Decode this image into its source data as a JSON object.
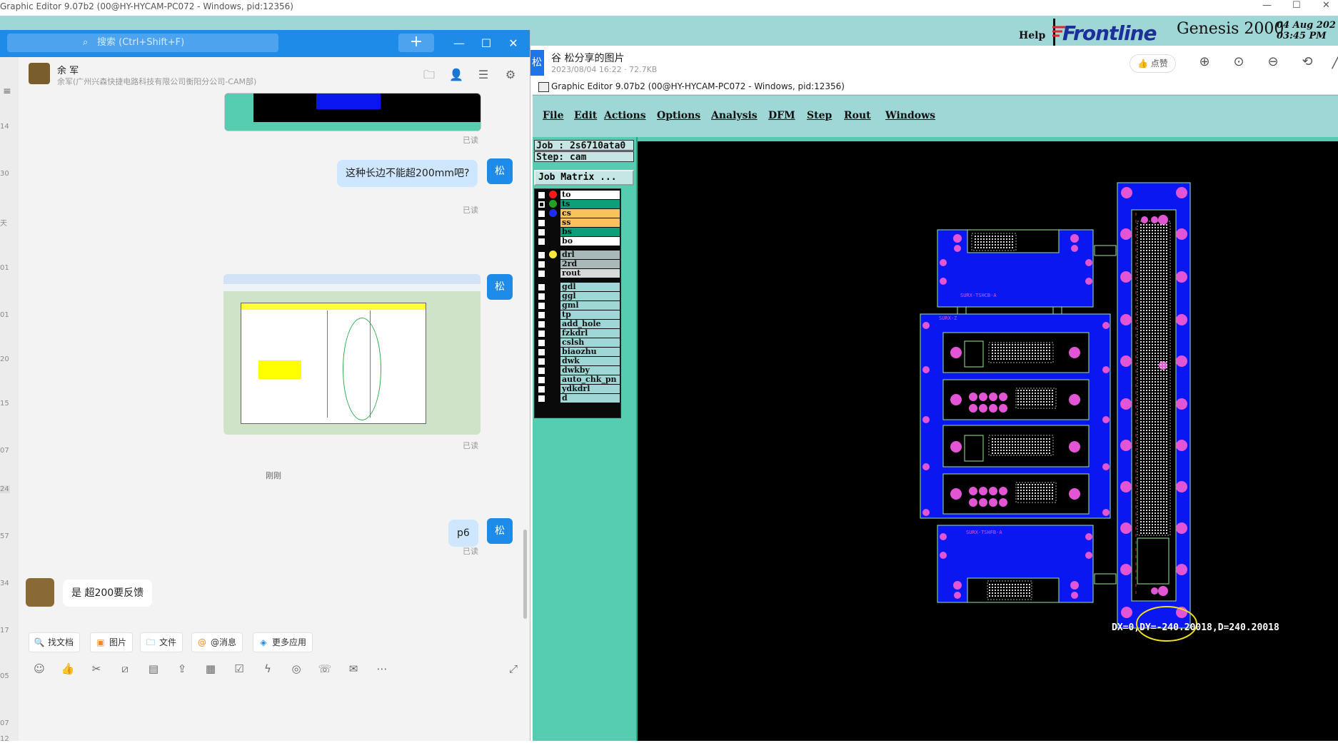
{
  "bg_window": {
    "title": "Graphic Editor 9.07b2 (00@HY-HYCAM-PC072 - Windows, pid:12356)",
    "help": "Help",
    "logo": "Frontline",
    "product": "Genesis 2000",
    "date": "04 Aug 202",
    "time": "03:45 PM",
    "controls": [
      "—",
      "☐",
      "✕"
    ]
  },
  "chat": {
    "search_placeholder": "搜索 (Ctrl+Shift+F)",
    "add_label": "+",
    "window_controls": [
      "—",
      "☐",
      "✕"
    ],
    "contact_name": "余 军",
    "contact_sub": "余军(广州兴森快捷电路科技有限公司衡阳分公司-CAM部)",
    "rail_numbers": [
      "14",
      "30",
      "天",
      "01",
      "01",
      "20",
      "15",
      "07",
      "24",
      "57",
      "34",
      "17",
      "05",
      "07",
      "12"
    ],
    "messages": {
      "read_label": "已读",
      "question": "这种长边不能超200mm吧?",
      "time_divider": "刚刚",
      "p6": "p6",
      "reply": "是 超200要反馈",
      "me_avatar": "松"
    },
    "toolbar": [
      {
        "icon": "doc-icon",
        "label": "找文档"
      },
      {
        "icon": "image-icon",
        "label": "图片"
      },
      {
        "icon": "folder-icon",
        "label": "文件"
      },
      {
        "icon": "at-icon",
        "label": "@消息"
      },
      {
        "icon": "apps-icon",
        "label": "更多应用"
      }
    ]
  },
  "viewer": {
    "avatar": "松",
    "title": "谷 松分享的图片",
    "subtitle": "2023/08/04 16:22 · 72.7KB",
    "like": "点赞"
  },
  "editor": {
    "title": "Graphic Editor 9.07b2 (00@HY-HYCAM-PC072 - Windows, pid:12356)",
    "menu": [
      "File",
      "Edit",
      "Actions",
      "Options",
      "Analysis",
      "DFM",
      "Step",
      "Rout",
      "Windows"
    ],
    "job": "Job : 2s6710ata0",
    "step": "Step: cam",
    "job_matrix": "Job Matrix ...",
    "layers": [
      {
        "name": "to",
        "dot": "#ff1a1a",
        "bg": "#ffffff",
        "checked": false
      },
      {
        "name": "ts",
        "dot": "#22a022",
        "bg": "#0e9f7a",
        "checked": true
      },
      {
        "name": "cs",
        "dot": "#1d2cff",
        "bg": "#f7c35a",
        "checked": false
      },
      {
        "name": "ss",
        "dot": "",
        "bg": "#f7c35a",
        "checked": false
      },
      {
        "name": "bs",
        "dot": "",
        "bg": "#0e9f7a",
        "checked": false
      },
      {
        "name": "bo",
        "dot": "",
        "bg": "#ffffff",
        "checked": false
      },
      {
        "name": "drl",
        "dot": "#ffe83a",
        "bg": "#a9b9b9",
        "checked": false
      },
      {
        "name": "2rd",
        "dot": "",
        "bg": "#a9b9b9",
        "checked": false
      },
      {
        "name": "rout",
        "dot": "",
        "bg": "#d9d9d9",
        "checked": false
      },
      {
        "name": "gdl",
        "dot": "",
        "bg": "#9fd6d6",
        "checked": false
      },
      {
        "name": "ggl",
        "dot": "",
        "bg": "#9fd6d6",
        "checked": false
      },
      {
        "name": "gml",
        "dot": "",
        "bg": "#9fd6d6",
        "checked": false
      },
      {
        "name": "tp",
        "dot": "",
        "bg": "#9fd6d6",
        "checked": false
      },
      {
        "name": "add_hole",
        "dot": "",
        "bg": "#9fd6d6",
        "checked": false
      },
      {
        "name": "fzkdrl",
        "dot": "",
        "bg": "#9fd6d6",
        "checked": false
      },
      {
        "name": "cslsh",
        "dot": "",
        "bg": "#9fd6d6",
        "checked": false
      },
      {
        "name": "biaozhu",
        "dot": "",
        "bg": "#9fd6d6",
        "checked": false
      },
      {
        "name": "dwk",
        "dot": "",
        "bg": "#9fd6d6",
        "checked": false
      },
      {
        "name": "dwkby",
        "dot": "",
        "bg": "#9fd6d6",
        "checked": false
      },
      {
        "name": "auto_chk_pn",
        "dot": "",
        "bg": "#9fd6d6",
        "checked": false
      },
      {
        "name": "ydkdrl",
        "dot": "",
        "bg": "#9fd6d6",
        "checked": false
      },
      {
        "name": "d",
        "dot": "",
        "bg": "#9fd6d6",
        "checked": false
      }
    ],
    "measure": "DX=0,DY=-240.20018,D=240.20018",
    "colors": {
      "board": "#0a17f0",
      "pad": "#e256d6",
      "outline": "#9be89b"
    }
  }
}
